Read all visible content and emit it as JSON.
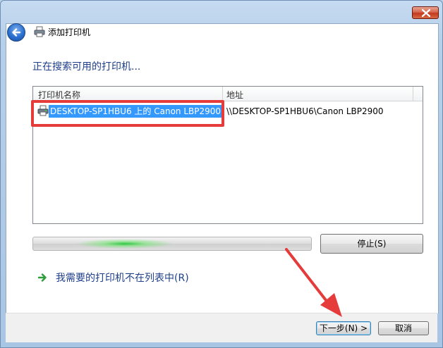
{
  "window": {
    "title": "添加打印机",
    "close_icon": "close-x-icon",
    "back_icon": "back-arrow-icon",
    "app_icon": "printer-icon"
  },
  "main": {
    "heading": "正在搜索可用的打印机...",
    "list": {
      "columns": [
        "打印机名称",
        "地址"
      ],
      "rows": [
        {
          "name": "DESKTOP-SP1HBU6 上的 Canon LBP2900",
          "address": "\\\\DESKTOP-SP1HBU6\\Canon LBP2900",
          "icon": "printer-icon",
          "selected": true
        }
      ]
    },
    "progress": {
      "state": "searching",
      "style": "indeterminate-green-glow"
    },
    "stop_label": "停止(S)",
    "not_listed_link": "我需要的打印机不在列表中(R)"
  },
  "footer": {
    "next_label": "下一步(N) >",
    "cancel_label": "取消"
  },
  "annotations": {
    "highlight_color": "#e53b3b",
    "arrow_color": "#e53b3b"
  }
}
